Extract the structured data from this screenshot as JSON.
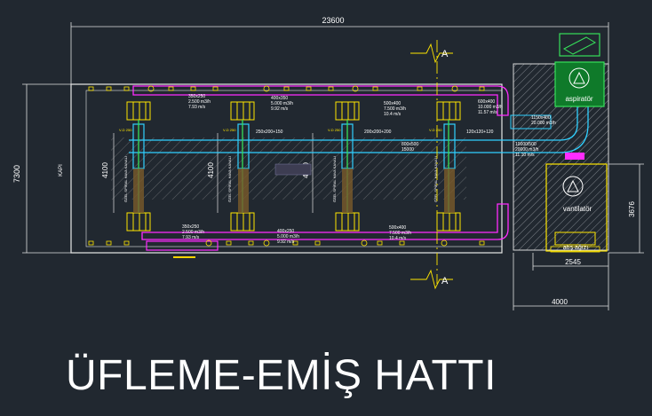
{
  "title": "ÜFLEME-EMİŞ HATTI",
  "dimensions": {
    "total_width": "23600",
    "height_left": "7300",
    "height_inner": "4100",
    "right_height": "3676",
    "bottom_fan": "2545",
    "bottom_right": "4000"
  },
  "section_marker": "A",
  "labels": {
    "kapi": "KAPI",
    "aspirator": "aspiratör",
    "vantilator": "vantilatör",
    "atis_agizi": "atış ağızı",
    "side_vent": "ÖZEL SPİRAL HAVA KANALI",
    "vd": "V-D 250"
  },
  "top_duct_notes": [
    {
      "size": "350x250",
      "flow": "2.500 m3/h",
      "speed": "7.93 m/s"
    },
    {
      "size": "400x350",
      "flow": "5.000 m3/h",
      "speed": "9.92 m/s"
    },
    {
      "size": "500x400",
      "flow": "7.500 m3/h",
      "speed": "10.4 m/s"
    },
    {
      "size": "600x400",
      "flow": "10.000 m3/h",
      "speed": "11.57 m/s"
    }
  ],
  "bottom_duct_notes": [
    {
      "size": "350x250",
      "flow": "2.500 m3/h",
      "speed": "7.93 m/s"
    },
    {
      "size": "400x250",
      "flow": "5.000 m3/h",
      "speed": "9.92 m/s"
    },
    {
      "size": "500x400",
      "flow": "7.500 m3/h",
      "speed": "10.4 m/s"
    }
  ],
  "center_notes": [
    "250x200+150",
    "200x200+200",
    "800x500",
    "15000",
    "120x120+120",
    "1150x400",
    "20.000 m3/h",
    "10000/500",
    "20000 m3/h",
    "11.10 m/s"
  ]
}
